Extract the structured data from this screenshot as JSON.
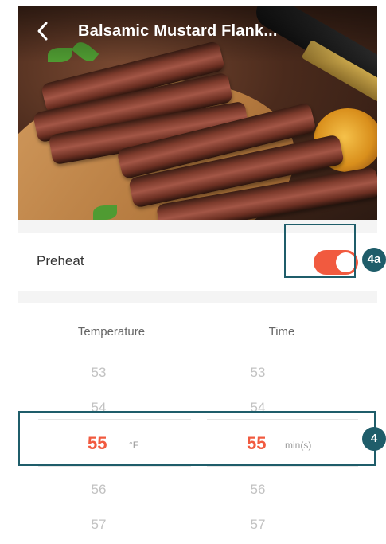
{
  "header": {
    "back_icon": "chevron-left-icon",
    "title": "Balsamic Mustard Flank..."
  },
  "preheat": {
    "label": "Preheat",
    "toggle_on": true,
    "accent_color": "#f15a3f"
  },
  "annotations": {
    "toggle_badge": "4a",
    "picker_badge": "4",
    "color": "#1f5d6a"
  },
  "picker": {
    "temperature": {
      "header": "Temperature",
      "above": [
        "53",
        "54"
      ],
      "selected": "55",
      "unit": "°F",
      "below": [
        "56",
        "57"
      ]
    },
    "time": {
      "header": "Time",
      "above": [
        "53",
        "54"
      ],
      "selected": "55",
      "unit": "min(s)",
      "below": [
        "56",
        "57"
      ]
    }
  }
}
